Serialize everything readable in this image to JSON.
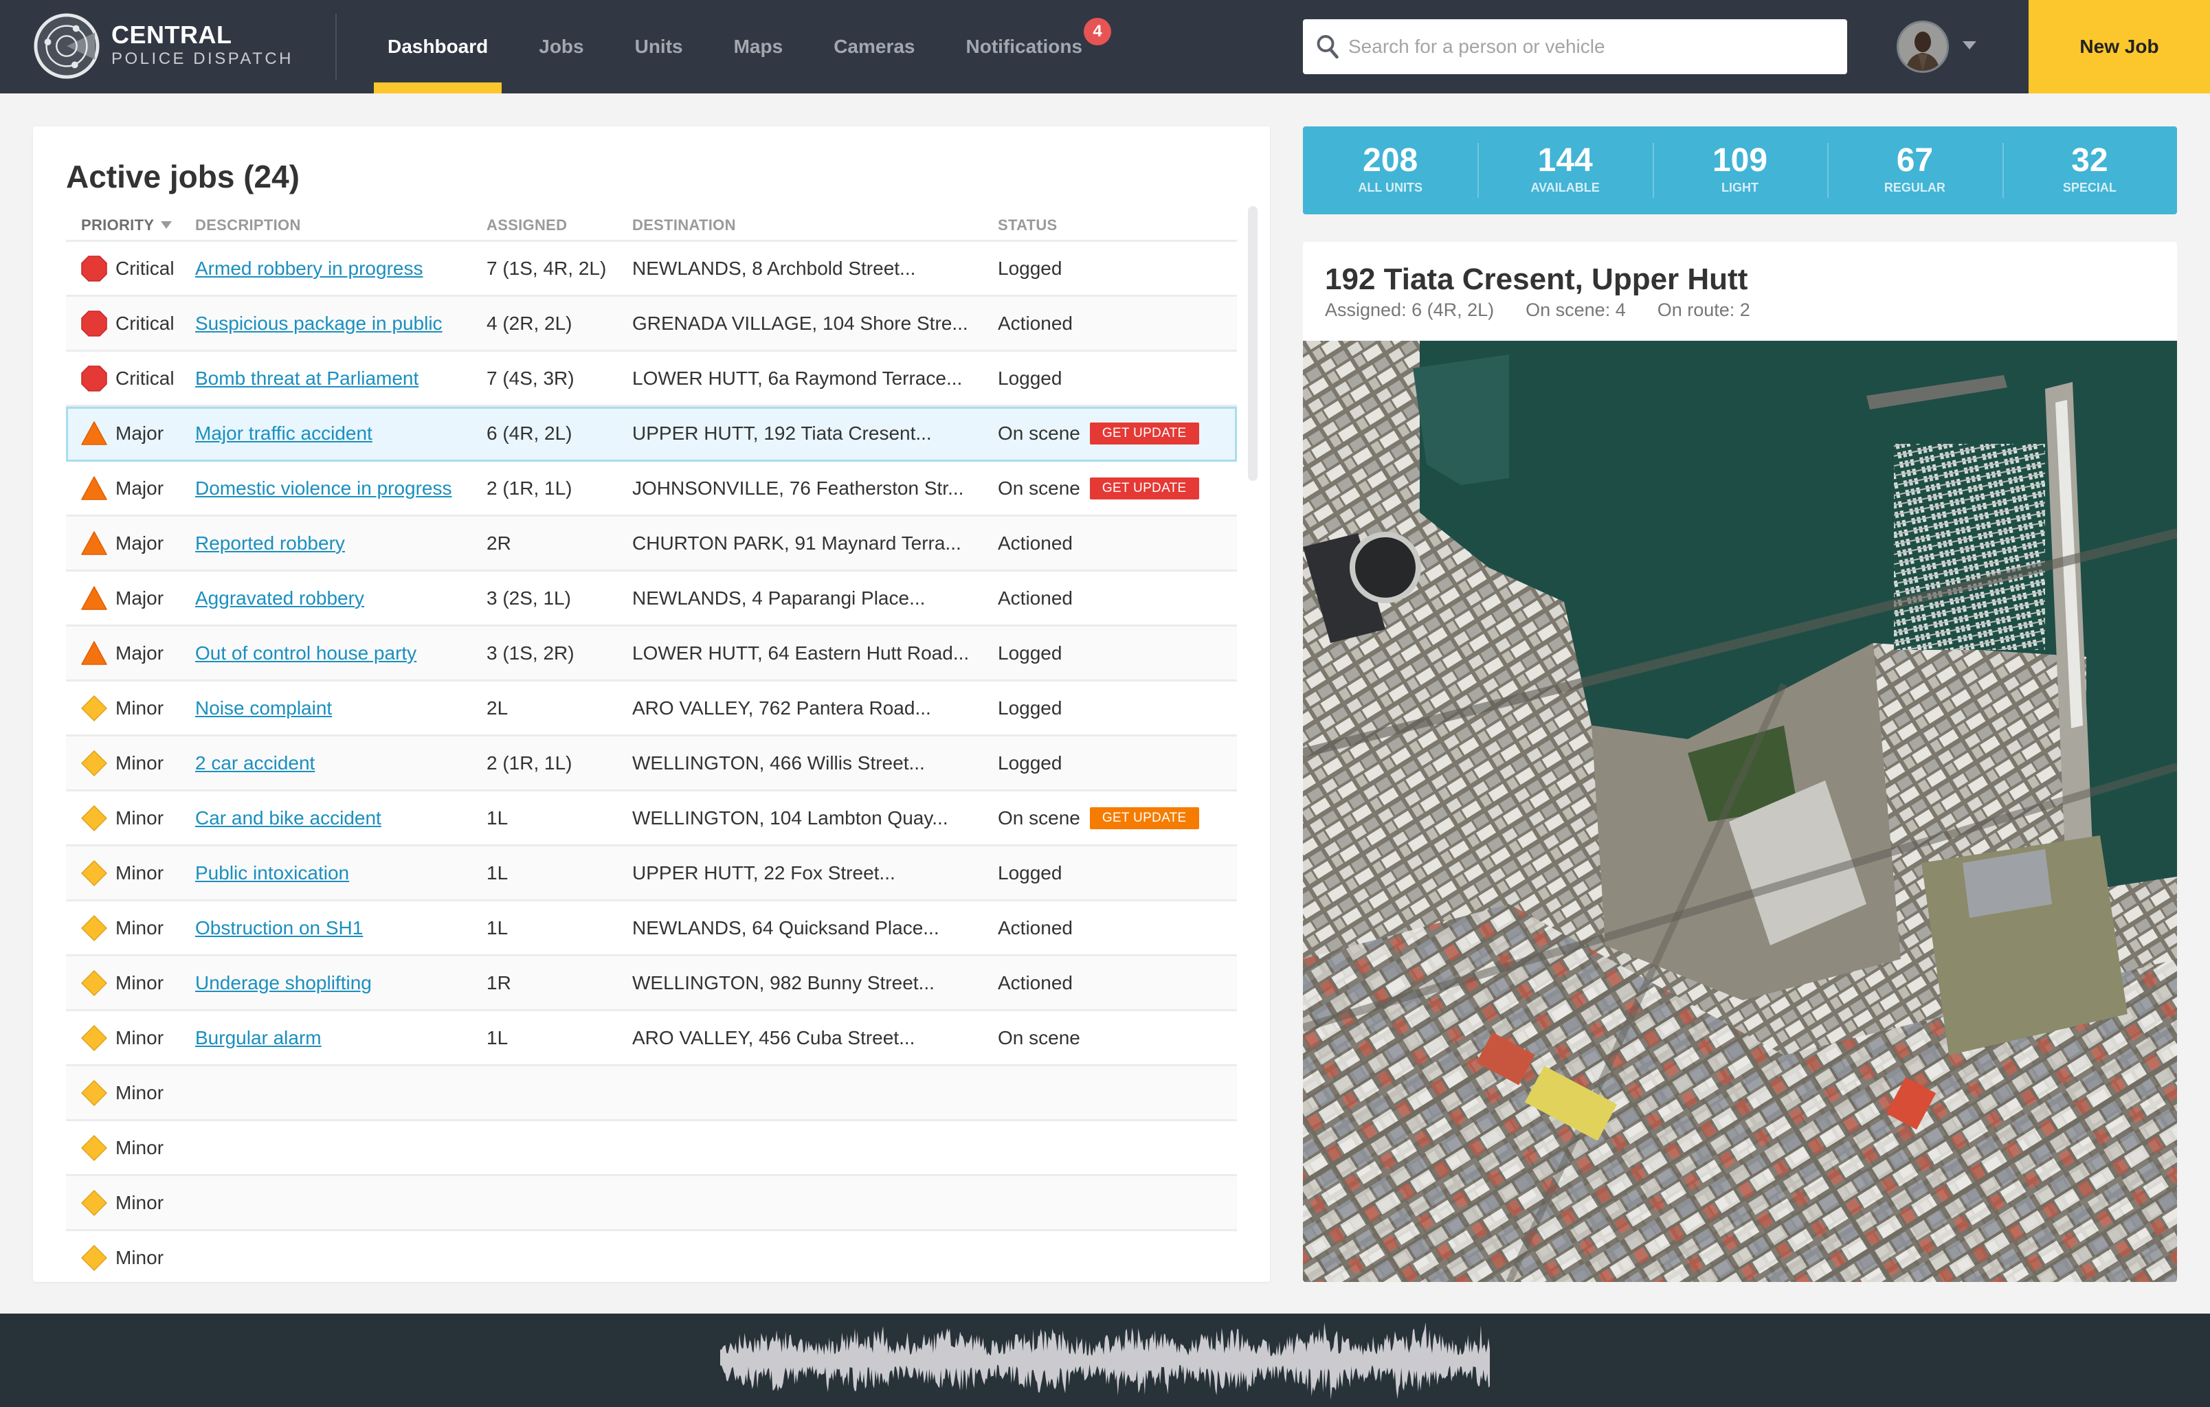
{
  "brand": {
    "title": "CENTRAL",
    "subtitle": "POLICE DISPATCH",
    "logo_icon": "radar-icon"
  },
  "nav": {
    "items": [
      {
        "label": "Dashboard",
        "active": true
      },
      {
        "label": "Jobs",
        "active": false
      },
      {
        "label": "Units",
        "active": false
      },
      {
        "label": "Maps",
        "active": false
      },
      {
        "label": "Cameras",
        "active": false
      },
      {
        "label": "Notifications",
        "active": false,
        "badge": "4"
      }
    ]
  },
  "search": {
    "placeholder": "Search for a person or vehicle",
    "value": "",
    "icon": "search-icon"
  },
  "user": {
    "avatar_icon": "avatar",
    "menu_icon": "caret-down-icon"
  },
  "actions": {
    "new_job_label": "New Job"
  },
  "colors": {
    "header_bg": "#313843",
    "accent_yellow": "#fcc72c",
    "stats_blue": "#42b4d6",
    "link_blue": "#1a8fbf",
    "critical_red": "#e53935",
    "major_orange": "#f5730f",
    "minor_yellow": "#fbbd2b",
    "update_red": "#e53935",
    "update_orange": "#f57c00",
    "badge_red": "#e85454",
    "footer_bg": "#283239"
  },
  "jobs": {
    "title": "Active jobs (24)",
    "columns": {
      "priority": "PRIORITY",
      "description": "DESCRIPTION",
      "assigned": "ASSIGNED",
      "destination": "DESTINATION",
      "status": "STATUS"
    },
    "sort_column": "priority",
    "rows": [
      {
        "priority": "Critical",
        "description": "Armed robbery in progress",
        "assigned": "7 (1S, 4R, 2L)",
        "destination": "NEWLANDS, 8 Archbold Street...",
        "status": "Logged",
        "action": ""
      },
      {
        "priority": "Critical",
        "description": "Suspicious package in public",
        "assigned": "4 (2R, 2L)",
        "destination": "GRENADA VILLAGE, 104 Shore Stre...",
        "status": "Actioned",
        "action": ""
      },
      {
        "priority": "Critical",
        "description": "Bomb threat at Parliament",
        "assigned": "7 (4S, 3R)",
        "destination": "LOWER HUTT, 6a Raymond Terrace...",
        "status": "Logged",
        "action": ""
      },
      {
        "priority": "Major",
        "description": "Major traffic accident",
        "assigned": "6 (4R, 2L)",
        "destination": "UPPER HUTT, 192 Tiata Cresent...",
        "status": "On scene",
        "action": "GET UPDATE",
        "action_color": "red",
        "selected": true
      },
      {
        "priority": "Major",
        "description": "Domestic violence in progress",
        "assigned": "2 (1R, 1L)",
        "destination": "JOHNSONVILLE, 76 Featherston Str...",
        "status": "On scene",
        "action": "GET UPDATE",
        "action_color": "red"
      },
      {
        "priority": "Major",
        "description": "Reported robbery",
        "assigned": "2R",
        "destination": "CHURTON PARK, 91 Maynard Terra...",
        "status": "Actioned",
        "action": ""
      },
      {
        "priority": "Major",
        "description": "Aggravated robbery",
        "assigned": "3 (2S, 1L)",
        "destination": "NEWLANDS, 4 Paparangi Place...",
        "status": "Actioned",
        "action": ""
      },
      {
        "priority": "Major",
        "description": "Out of control house party",
        "assigned": "3 (1S, 2R)",
        "destination": "LOWER HUTT, 64 Eastern Hutt Road...",
        "status": "Logged",
        "action": ""
      },
      {
        "priority": "Minor",
        "description": "Noise complaint",
        "assigned": "2L",
        "destination": "ARO VALLEY, 762 Pantera Road...",
        "status": "Logged",
        "action": ""
      },
      {
        "priority": "Minor",
        "description": "2 car accident",
        "assigned": "2 (1R, 1L)",
        "destination": "WELLINGTON, 466 Willis Street...",
        "status": "Logged",
        "action": ""
      },
      {
        "priority": "Minor",
        "description": "Car and bike accident",
        "assigned": "1L",
        "destination": "WELLINGTON, 104 Lambton Quay...",
        "status": "On scene",
        "action": "GET UPDATE",
        "action_color": "orange"
      },
      {
        "priority": "Minor",
        "description": "Public intoxication",
        "assigned": "1L",
        "destination": "UPPER HUTT, 22 Fox Street...",
        "status": "Logged",
        "action": ""
      },
      {
        "priority": "Minor",
        "description": "Obstruction on SH1",
        "assigned": "1L",
        "destination": "NEWLANDS, 64 Quicksand Place...",
        "status": "Actioned",
        "action": ""
      },
      {
        "priority": "Minor",
        "description": "Underage shoplifting",
        "assigned": "1R",
        "destination": "WELLINGTON, 982 Bunny Street...",
        "status": "Actioned",
        "action": ""
      },
      {
        "priority": "Minor",
        "description": "Burgular alarm",
        "assigned": "1L",
        "destination": "ARO VALLEY, 456 Cuba Street...",
        "status": "On scene",
        "action": ""
      },
      {
        "priority": "Minor",
        "description": "",
        "assigned": "",
        "destination": "",
        "status": "",
        "action": ""
      },
      {
        "priority": "Minor",
        "description": "",
        "assigned": "",
        "destination": "",
        "status": "",
        "action": ""
      },
      {
        "priority": "Minor",
        "description": "",
        "assigned": "",
        "destination": "",
        "status": "",
        "action": ""
      },
      {
        "priority": "Minor",
        "description": "",
        "assigned": "",
        "destination": "",
        "status": "",
        "action": ""
      }
    ],
    "scroll_position": 0
  },
  "stats": [
    {
      "value": "208",
      "label": "ALL UNITS"
    },
    {
      "value": "144",
      "label": "AVAILABLE"
    },
    {
      "value": "109",
      "label": "LIGHT"
    },
    {
      "value": "67",
      "label": "REGULAR"
    },
    {
      "value": "32",
      "label": "SPECIAL"
    }
  ],
  "job_detail": {
    "title": "192 Tiata Cresent, Upper Hutt",
    "assigned": "Assigned: 6 (4R, 2L)",
    "on_scene": "On scene: 4",
    "on_route": "On route: 2",
    "map_type": "satellite-map"
  },
  "footer": {
    "audio_icon": "audio-waveform"
  }
}
